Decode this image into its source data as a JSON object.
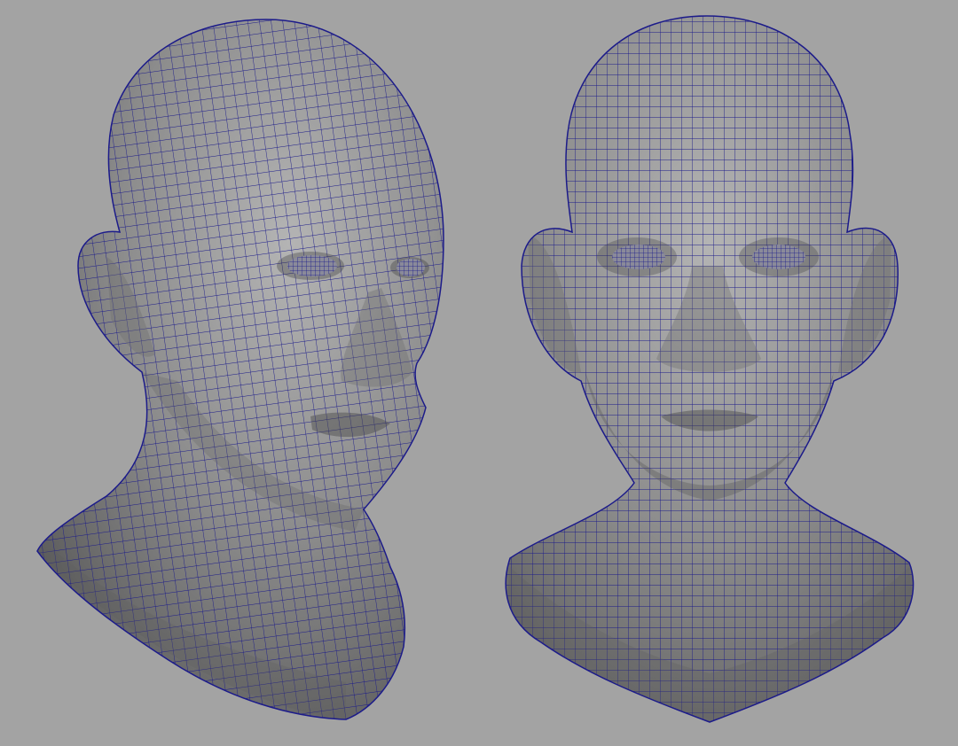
{
  "scene": {
    "background_color": "#a3a3a3",
    "mesh_shade_color": "#8c8c8c",
    "mesh_light_color": "#b4b4b4",
    "mesh_dark_color": "#5e5e5e",
    "wireframe_color": "#1c1b8a",
    "models": [
      {
        "name": "head-three-quarter-view",
        "view": "three-quarter"
      },
      {
        "name": "head-front-view",
        "view": "front"
      }
    ]
  }
}
